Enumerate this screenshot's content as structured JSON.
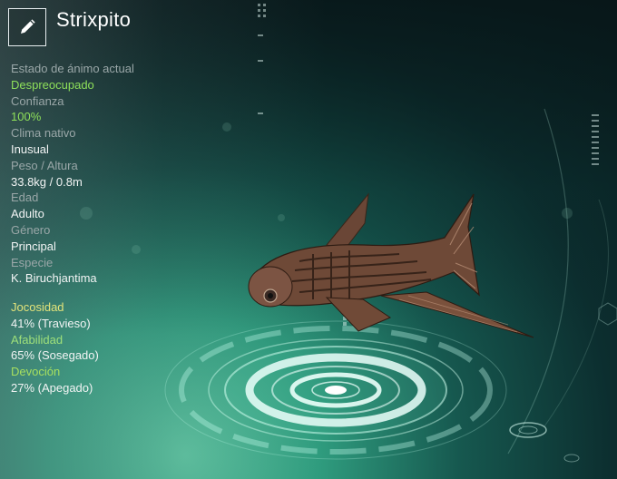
{
  "creature": {
    "name": "Strixpito"
  },
  "stats": [
    {
      "label": "Estado de ánimo actual",
      "value": "Despreocupado",
      "value_color": "green"
    },
    {
      "label": "Confianza",
      "value": "100%",
      "value_color": "green"
    },
    {
      "label": "Clima nativo",
      "value": "Inusual",
      "value_color": "white"
    },
    {
      "label": "Peso / Altura",
      "value": "33.8kg / 0.8m",
      "value_color": "white"
    },
    {
      "label": "Edad",
      "value": "Adulto",
      "value_color": "white"
    },
    {
      "label": "Género",
      "value": "Principal",
      "value_color": "white"
    },
    {
      "label": "Especie",
      "value": "K. Biruchjantima",
      "value_color": "white"
    }
  ],
  "traits": [
    {
      "label": "Jocosidad",
      "value": "41% (Travieso)",
      "percent": 41
    },
    {
      "label": "Afabilidad",
      "value": "65% (Sosegado)",
      "percent": 65
    },
    {
      "label": "Devoción",
      "value": "27% (Apegado)",
      "percent": 27
    }
  ],
  "icons": {
    "edit": "pencil-icon"
  },
  "colors": {
    "accent_green": "#8ee05a",
    "label_gray": "#9aa7a8",
    "jocosidad": "#e3e37a",
    "afabilidad": "#9fe07a",
    "devocion": "#a7df5f"
  }
}
